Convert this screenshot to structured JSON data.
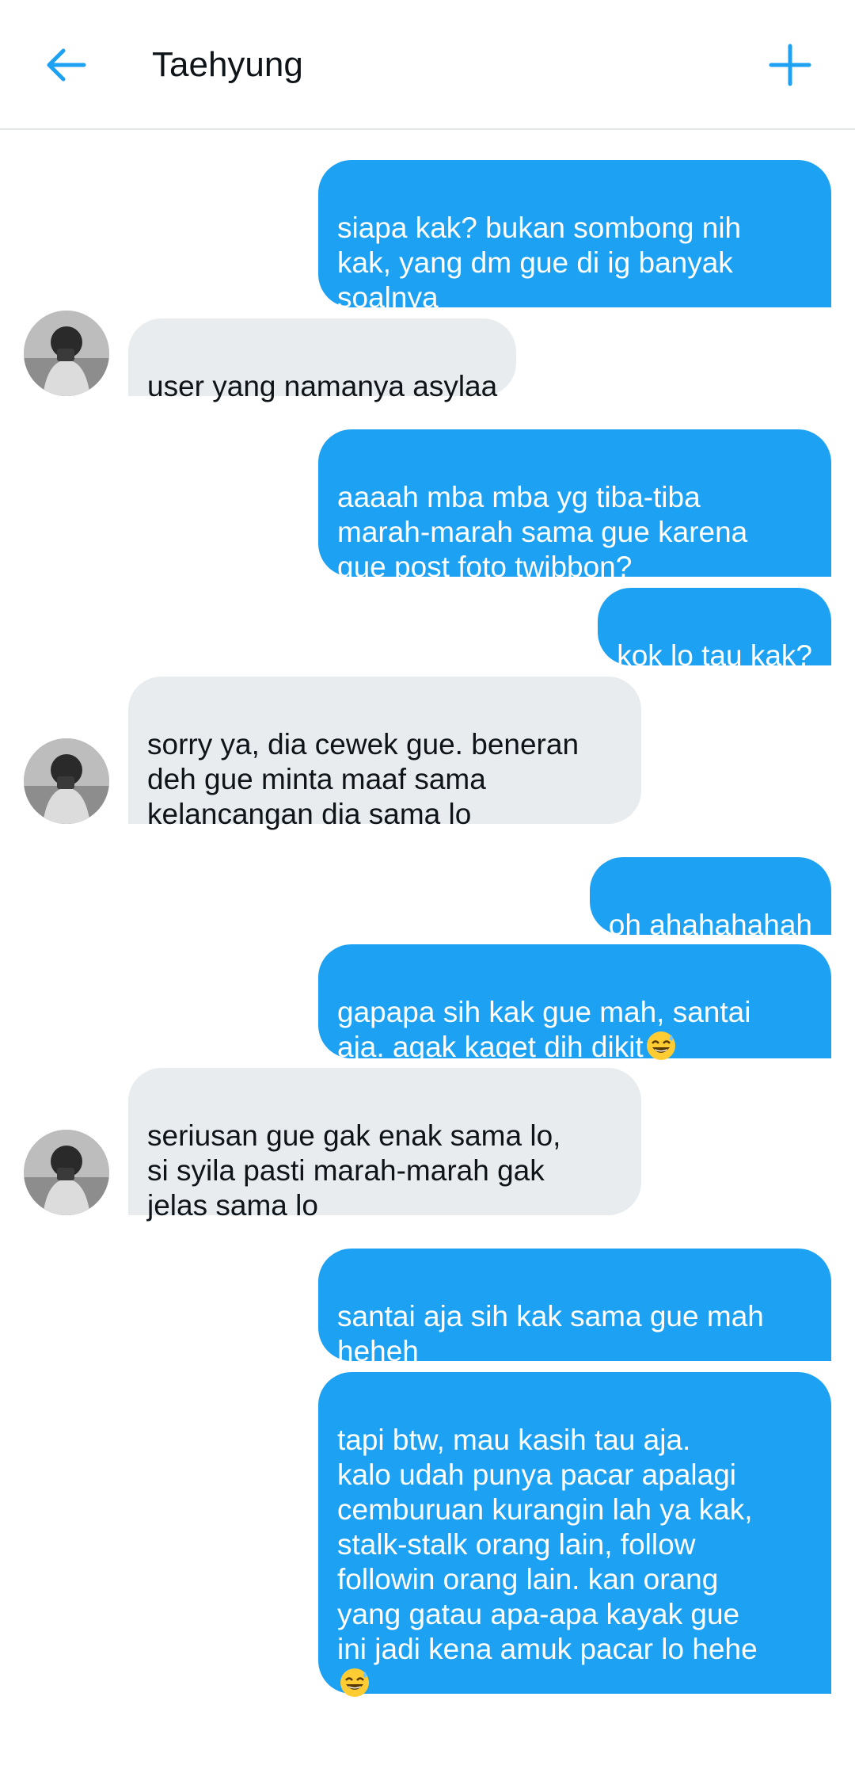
{
  "header": {
    "title": "Taehyung",
    "back_icon": "arrow-left-icon",
    "add_icon": "plus-icon"
  },
  "colors": {
    "accent": "#1da1f2",
    "incoming_bubble": "#e8ecef",
    "text": "#0f1419"
  },
  "messages": [
    {
      "direction": "out",
      "text": "siapa kak? bukan sombong nih\nkak, yang dm gue di ig banyak\nsoalnya"
    },
    {
      "direction": "in",
      "text": "user yang namanya asylaa"
    },
    {
      "direction": "out",
      "text": "aaaah mba mba yg tiba-tiba\nmarah-marah sama gue karena\ngue post foto twibbon?"
    },
    {
      "direction": "out",
      "text": "kok lo tau kak?"
    },
    {
      "direction": "in",
      "text": "sorry ya, dia cewek gue. beneran\ndeh gue minta maaf sama\nkelancangan dia sama lo"
    },
    {
      "direction": "out",
      "text": "oh ahahahahah"
    },
    {
      "direction": "out",
      "text": "gapapa sih kak gue mah, santai\naja. agak kaget dih dikit",
      "emoji": "grinning-sweat-emoji"
    },
    {
      "direction": "in",
      "text": "seriusan gue gak enak sama lo,\nsi syila pasti marah-marah gak\njelas sama lo"
    },
    {
      "direction": "out",
      "text": "santai aja sih kak sama gue mah\nheheh"
    },
    {
      "direction": "out",
      "text": "tapi btw, mau kasih tau aja.\nkalo udah punya pacar apalagi\ncemburuan kurangin lah ya kak,\nstalk-stalk orang lain, follow\nfollowin orang lain. kan orang\nyang gatau apa-apa kayak gue\nini jadi kena amuk pacar lo hehe\n",
      "emoji": "grinning-sweat-emoji"
    }
  ]
}
